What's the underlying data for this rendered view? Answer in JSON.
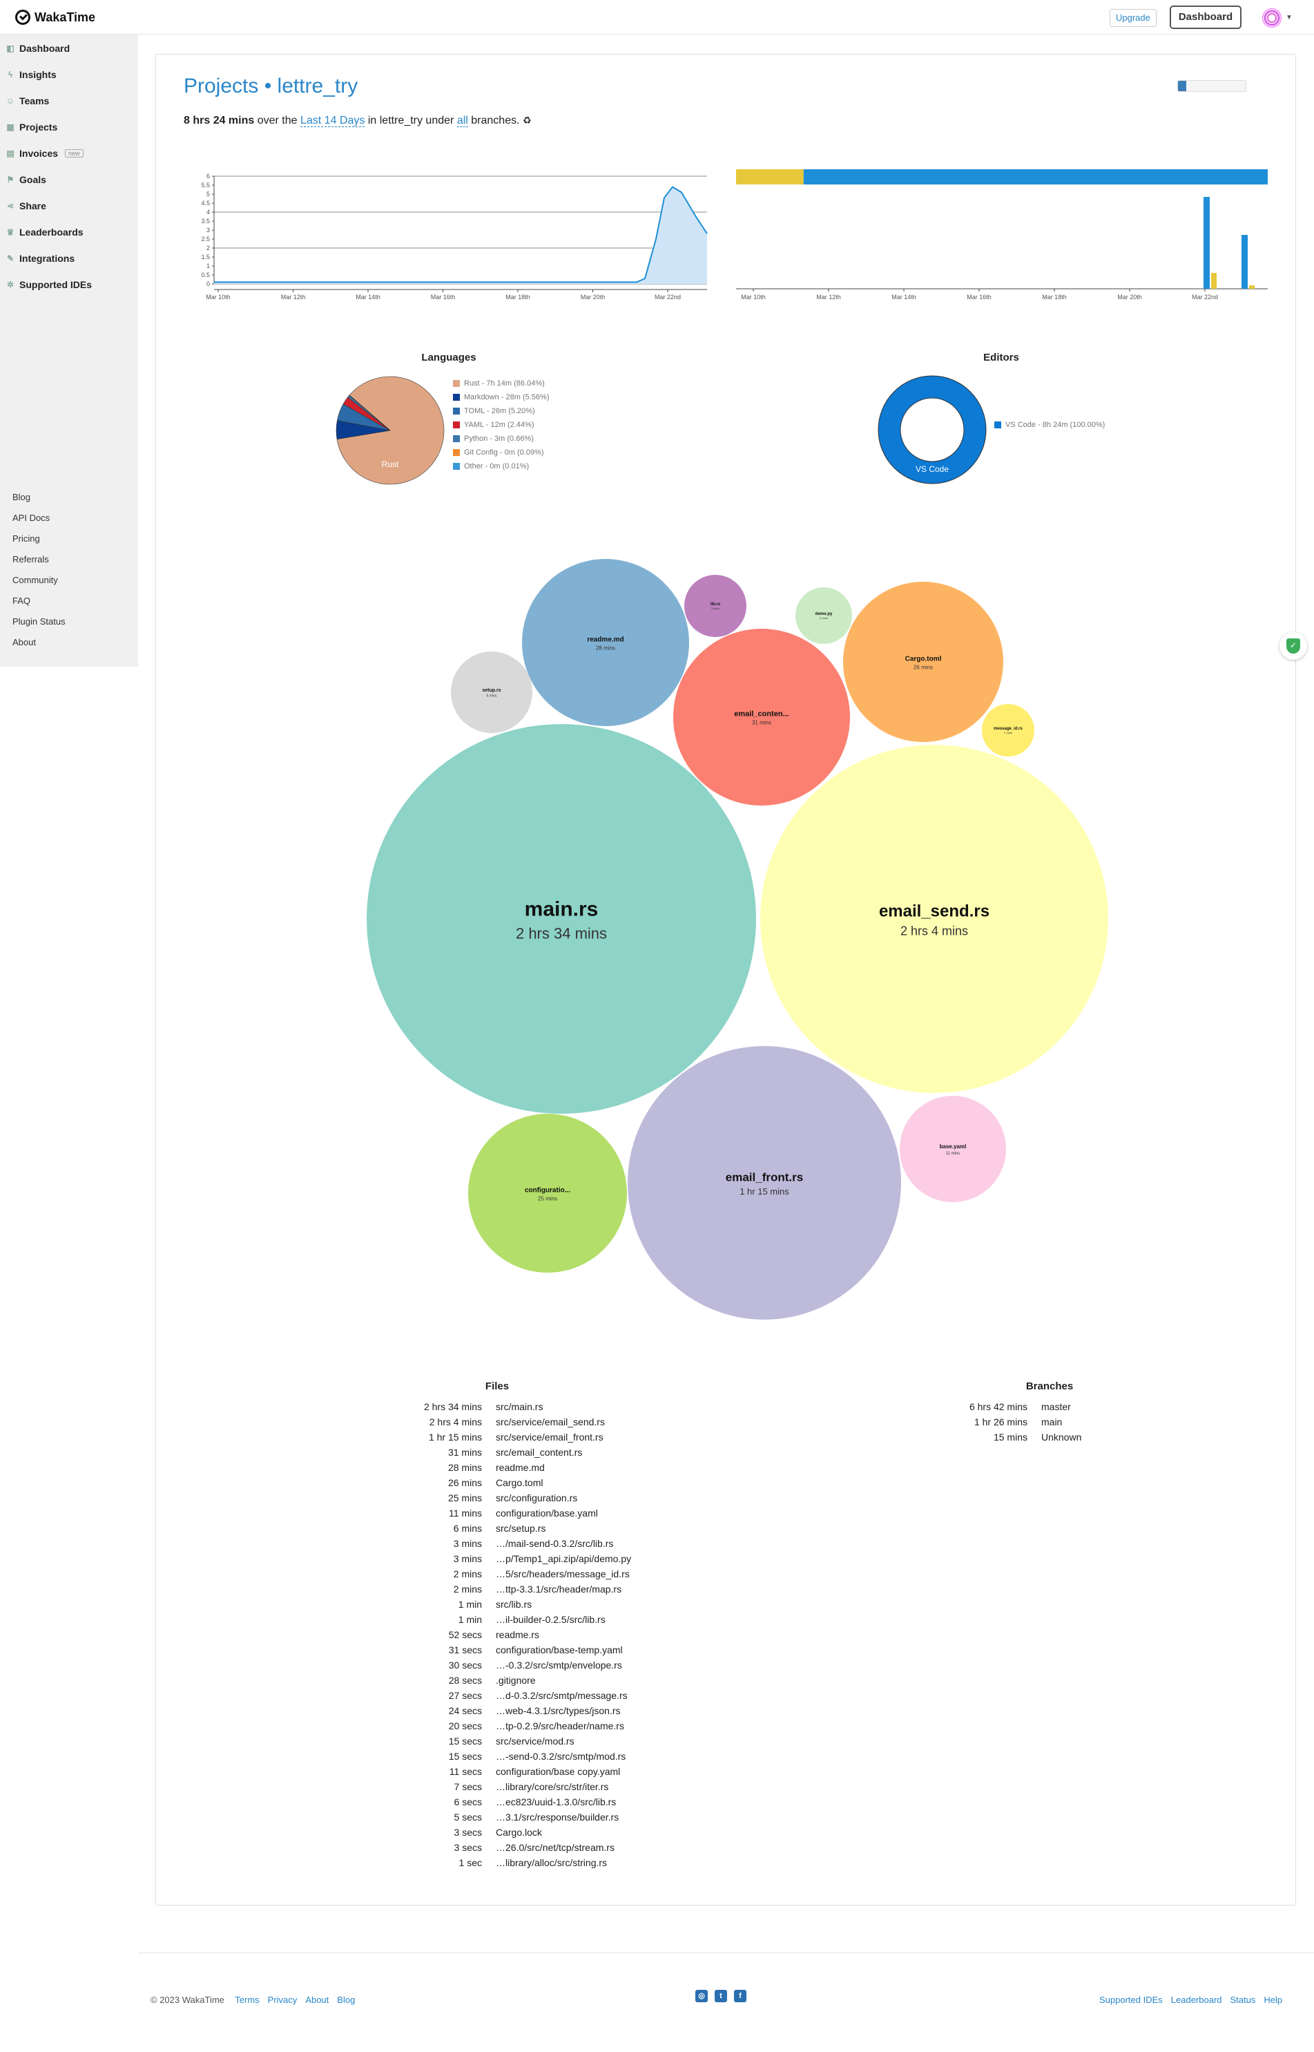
{
  "header": {
    "app_name": "WakaTime",
    "upgrade_label": "Upgrade",
    "dashboard_label": "Dashboard"
  },
  "sidebar": {
    "items": [
      {
        "label": "Dashboard",
        "icon": "dashboard-icon"
      },
      {
        "label": "Insights",
        "icon": "bolt-icon"
      },
      {
        "label": "Teams",
        "icon": "users-icon"
      },
      {
        "label": "Projects",
        "icon": "grid-icon"
      },
      {
        "label": "Invoices",
        "icon": "document-icon",
        "badge": "new"
      },
      {
        "label": "Goals",
        "icon": "flag-icon"
      },
      {
        "label": "Share",
        "icon": "share-icon"
      },
      {
        "label": "Leaderboards",
        "icon": "trophy-icon"
      },
      {
        "label": "Integrations",
        "icon": "wrench-icon"
      },
      {
        "label": "Supported IDEs",
        "icon": "gear-icon"
      }
    ],
    "footer_links": [
      "Blog",
      "API Docs",
      "Pricing",
      "Referrals",
      "Community",
      "FAQ",
      "Plugin Status",
      "About"
    ]
  },
  "project": {
    "title": "Projects • lettre_try",
    "total": "8 hrs 24 mins",
    "over_the": "over the",
    "range": "Last 14 Days",
    "in_text": "in lettre_try under",
    "branches_link": "all",
    "branches_text": "branches.",
    "progress_fraction": 0.12
  },
  "timeline_chart": {
    "type": "area",
    "x_ticks": [
      "Mar 10th",
      "Mar 12th",
      "Mar 14th",
      "Mar 16th",
      "Mar 18th",
      "Mar 20th",
      "Mar 22nd"
    ],
    "y_ticks": [
      "0",
      "0.5",
      "1",
      "1.5",
      "2",
      "2.5",
      "3",
      "3.5",
      "4",
      "4.5",
      "5",
      "5.5",
      "6"
    ],
    "ylim": [
      0,
      6
    ],
    "series_color": "#1f8ed8"
  },
  "stacked_chart": {
    "type": "bar",
    "x_ticks": [
      "Mar 10th",
      "Mar 12th",
      "Mar 14th",
      "Mar 16th",
      "Mar 18th",
      "Mar 20th",
      "Mar 22nd"
    ],
    "top_bar_colors": [
      "#e6c83a",
      "#1f8ed8"
    ],
    "top_bar_split": 0.127
  },
  "chart_data": [
    {
      "type": "pie",
      "title": "Languages",
      "slices": [
        {
          "label": "Rust - 7h 14m (86.04%)",
          "name": "Rust",
          "value": 86.04,
          "color": "#dfa583"
        },
        {
          "label": "Markdown - 28m (5.56%)",
          "name": "Markdown",
          "value": 5.56,
          "color": "#0a3d91"
        },
        {
          "label": "TOML - 26m (5.20%)",
          "name": "TOML",
          "value": 5.2,
          "color": "#2c6aa8"
        },
        {
          "label": "YAML - 12m (2.44%)",
          "name": "YAML",
          "value": 2.44,
          "color": "#d0202a"
        },
        {
          "label": "Python - 3m (0.66%)",
          "name": "Python",
          "value": 0.66,
          "color": "#3b76ae"
        },
        {
          "label": "Git Config - 0m (0.09%)",
          "name": "Git Config",
          "value": 0.09,
          "color": "#f08c2e"
        },
        {
          "label": "Other - 0m (0.01%)",
          "name": "Other",
          "value": 0.01,
          "color": "#3a9ad8"
        }
      ],
      "inner_label": "Rust"
    },
    {
      "type": "pie",
      "title": "Editors",
      "slices": [
        {
          "label": "VS Code - 8h 24m (100.00%)",
          "name": "VS Code",
          "value": 100,
          "color": "#0d7ad4"
        }
      ],
      "inner_label": "VS Code"
    },
    {
      "type": "bubble",
      "title": "",
      "bubbles": [
        {
          "name": "main.rs",
          "time": "2 hrs 34 mins",
          "color": "#8dd3c7"
        },
        {
          "name": "email_send.rs",
          "time": "2 hrs 4 mins",
          "color": "#ffffb3"
        },
        {
          "name": "email_front.rs",
          "time": "1 hr 15 mins",
          "color": "#bebada"
        },
        {
          "name": "email_conten...",
          "time": "31 mins",
          "color": "#fb8072"
        },
        {
          "name": "readme.md",
          "time": "28 mins",
          "color": "#80b1d3"
        },
        {
          "name": "Cargo.toml",
          "time": "26 mins",
          "color": "#fdb462"
        },
        {
          "name": "configuratio...",
          "time": "25 mins",
          "color": "#b3de69"
        },
        {
          "name": "base.yaml",
          "time": "11 mins",
          "color": "#fccde5"
        },
        {
          "name": "setup.rs",
          "time": "6 mins",
          "color": "#d9d9d9"
        },
        {
          "name": "lib.rs",
          "time": "3 mins",
          "color": "#bc80bd"
        },
        {
          "name": "demo.py",
          "time": "3 mins",
          "color": "#ccebc5"
        },
        {
          "name": "message_id.rs",
          "time": "2 mins",
          "color": "#ffed6f"
        }
      ]
    }
  ],
  "files": {
    "title": "Files",
    "rows": [
      [
        "2 hrs 34 mins",
        "src/main.rs"
      ],
      [
        "2 hrs 4 mins",
        "src/service/email_send.rs"
      ],
      [
        "1 hr 15 mins",
        "src/service/email_front.rs"
      ],
      [
        "31 mins",
        "src/email_content.rs"
      ],
      [
        "28 mins",
        "readme.md"
      ],
      [
        "26 mins",
        "Cargo.toml"
      ],
      [
        "25 mins",
        "src/configuration.rs"
      ],
      [
        "11 mins",
        "configuration/base.yaml"
      ],
      [
        "6 mins",
        "src/setup.rs"
      ],
      [
        "3 mins",
        "…/mail-send-0.3.2/src/lib.rs"
      ],
      [
        "3 mins",
        "…p/Temp1_api.zip/api/demo.py"
      ],
      [
        "2 mins",
        "…5/src/headers/message_id.rs"
      ],
      [
        "2 mins",
        "…ttp-3.3.1/src/header/map.rs"
      ],
      [
        "1 min",
        "src/lib.rs"
      ],
      [
        "1 min",
        "…il-builder-0.2.5/src/lib.rs"
      ],
      [
        "52 secs",
        "readme.rs"
      ],
      [
        "31 secs",
        "configuration/base-temp.yaml"
      ],
      [
        "30 secs",
        "…-0.3.2/src/smtp/envelope.rs"
      ],
      [
        "28 secs",
        ".gitignore"
      ],
      [
        "27 secs",
        "…d-0.3.2/src/smtp/message.rs"
      ],
      [
        "24 secs",
        "…web-4.3.1/src/types/json.rs"
      ],
      [
        "20 secs",
        "…tp-0.2.9/src/header/name.rs"
      ],
      [
        "15 secs",
        "src/service/mod.rs"
      ],
      [
        "15 secs",
        "…-send-0.3.2/src/smtp/mod.rs"
      ],
      [
        "11 secs",
        "configuration/base copy.yaml"
      ],
      [
        "7 secs",
        "…library/core/src/str/iter.rs"
      ],
      [
        "6 secs",
        "…ec823/uuid-1.3.0/src/lib.rs"
      ],
      [
        "5 secs",
        "…3.1/src/response/builder.rs"
      ],
      [
        "3 secs",
        "Cargo.lock"
      ],
      [
        "3 secs",
        "…26.0/src/net/tcp/stream.rs"
      ],
      [
        "1 sec",
        "…library/alloc/src/string.rs"
      ]
    ]
  },
  "branches": {
    "title": "Branches",
    "rows": [
      [
        "6 hrs 42 mins",
        "master"
      ],
      [
        "1 hr 26 mins",
        "main"
      ],
      [
        "15 mins",
        "Unknown"
      ]
    ]
  },
  "footer": {
    "copyright": "© 2023 WakaTime",
    "left_links": [
      "Terms",
      "Privacy",
      "About",
      "Blog"
    ],
    "right_links": [
      "Supported IDEs",
      "Leaderboard",
      "Status",
      "Help"
    ]
  }
}
